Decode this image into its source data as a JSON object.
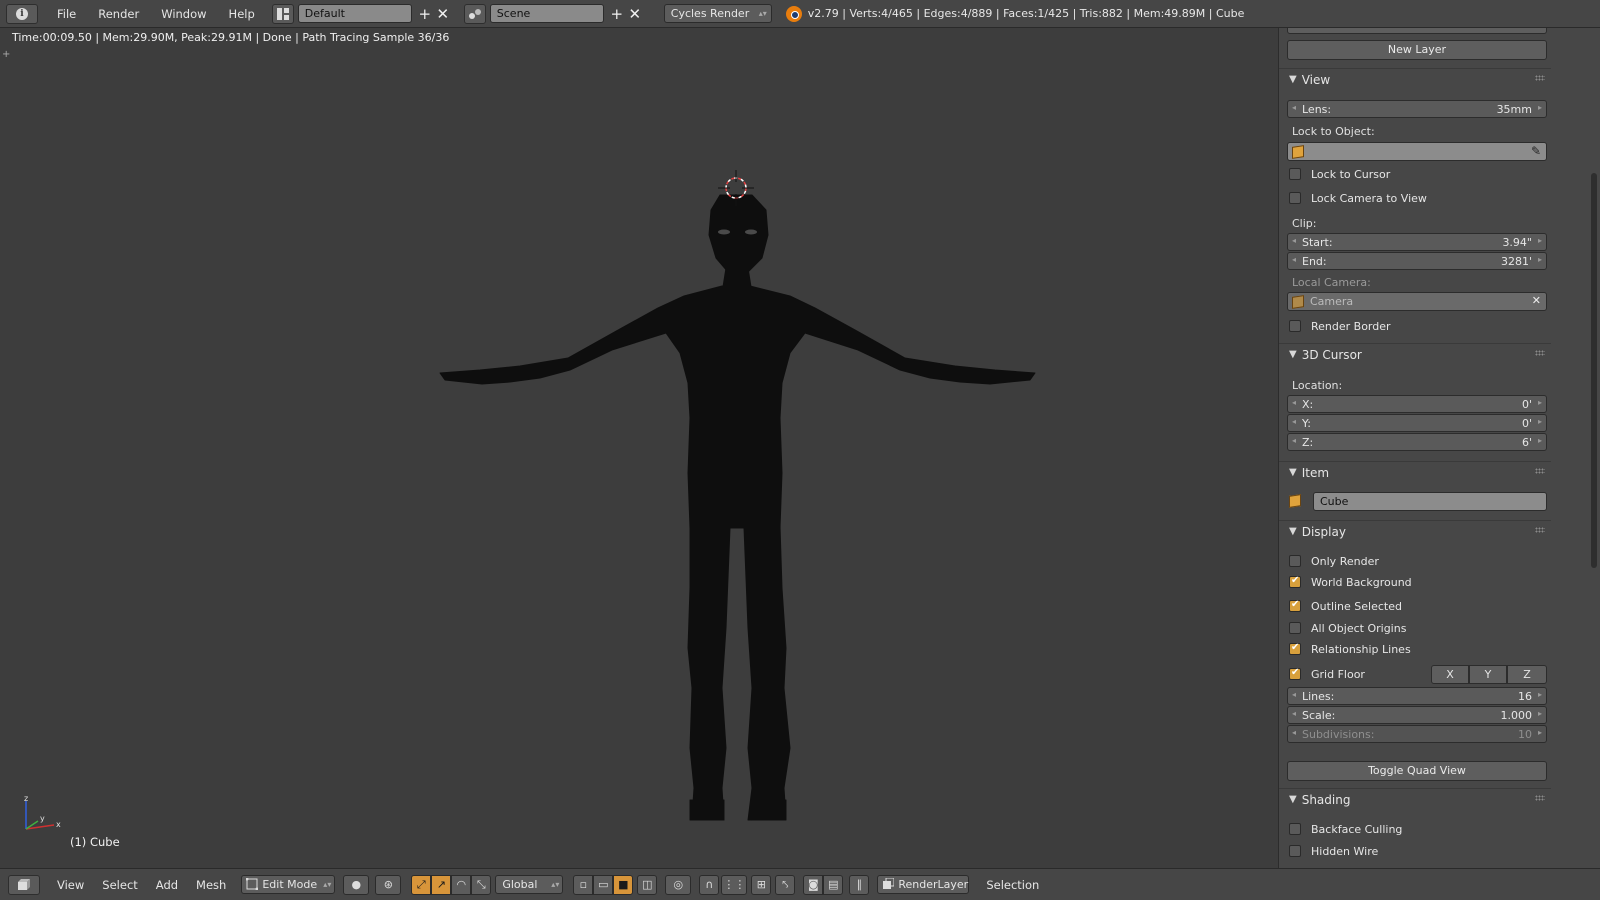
{
  "header": {
    "menus": [
      "File",
      "Render",
      "Window",
      "Help"
    ],
    "layout_name": "Default",
    "scene_name": "Scene",
    "render_engine": "Cycles Render",
    "stats": "v2.79 | Verts:4/465 | Edges:4/889 | Faces:1/425 | Tris:882 | Mem:49.89M | Cube"
  },
  "viewport": {
    "render_status": "Time:00:09.50 | Mem:29.90M, Peak:29.91M | Done | Path Tracing Sample 36/36",
    "object_label": "(1) Cube",
    "axis_labels": {
      "x": "x",
      "y": "y",
      "z": "z"
    }
  },
  "panel": {
    "new_layer_label": "New Layer",
    "view": {
      "title": "View",
      "lens_label": "Lens:",
      "lens_value": "35mm",
      "lock_to_object_label": "Lock to Object:",
      "lock_to_cursor_label": "Lock to Cursor",
      "lock_camera_label": "Lock Camera to View",
      "clip_label": "Clip:",
      "clip_start_label": "Start:",
      "clip_start_value": "3.94\"",
      "clip_end_label": "End:",
      "clip_end_value": "3281'",
      "local_camera_label": "Local Camera:",
      "local_camera_value": "Camera",
      "render_border_label": "Render Border"
    },
    "cursor": {
      "title": "3D Cursor",
      "location_label": "Location:",
      "x_label": "X:",
      "x_value": "0'",
      "y_label": "Y:",
      "y_value": "0'",
      "z_label": "Z:",
      "z_value": "6'"
    },
    "item": {
      "title": "Item",
      "name": "Cube"
    },
    "display": {
      "title": "Display",
      "only_render_label": "Only Render",
      "world_background_label": "World Background",
      "outline_selected_label": "Outline Selected",
      "all_object_origins_label": "All Object Origins",
      "relationship_lines_label": "Relationship Lines",
      "grid_floor_label": "Grid Floor",
      "axis_x": "X",
      "axis_y": "Y",
      "axis_z": "Z",
      "lines_label": "Lines:",
      "lines_value": "16",
      "scale_label": "Scale:",
      "scale_value": "1.000",
      "subdivisions_label": "Subdivisions:",
      "subdivisions_value": "10",
      "toggle_quad_label": "Toggle Quad View"
    },
    "shading": {
      "title": "Shading",
      "backface_culling_label": "Backface Culling",
      "hidden_wire_label": "Hidden Wire"
    }
  },
  "footer": {
    "menus": [
      "View",
      "Select",
      "Add",
      "Mesh"
    ],
    "mode": "Edit Mode",
    "orientation": "Global",
    "render_layer": "RenderLayer",
    "selection_label": "Selection"
  },
  "colors": {
    "accent": "#d8953a",
    "viewport_bg": "#3d3d3d",
    "figure": "#0e0e0e"
  }
}
